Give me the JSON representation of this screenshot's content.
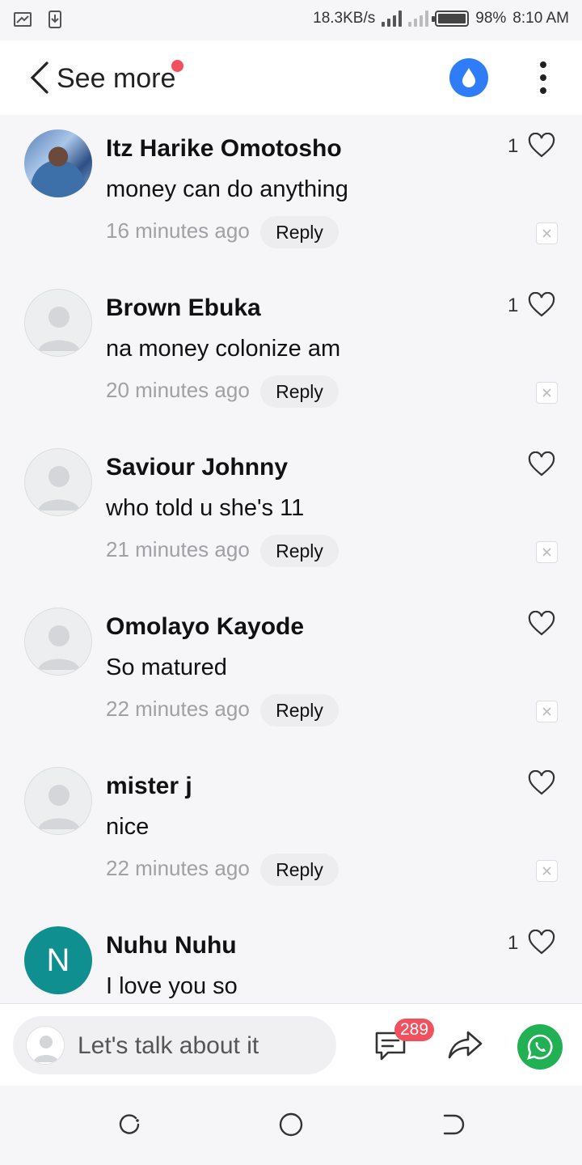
{
  "status_bar": {
    "net_speed": "18.3KB/s",
    "battery": "98%",
    "time": "8:10 AM",
    "battery_level": 0.98
  },
  "header": {
    "back_label": "See more",
    "accent": "#2f7df6",
    "dot_color": "#f1505f"
  },
  "comments": [
    {
      "name": "Itz Harike Omotosho",
      "text": "money can do anything",
      "time": "16 minutes ago",
      "reply": "Reply",
      "likes": "1",
      "avatar": "photo"
    },
    {
      "name": "Brown Ebuka",
      "text": "na money colonize am",
      "time": "20 minutes ago",
      "reply": "Reply",
      "likes": "1",
      "avatar": "default"
    },
    {
      "name": "Saviour Johnny",
      "text": "who told u she's 11",
      "time": "21 minutes ago",
      "reply": "Reply",
      "likes": "",
      "avatar": "default"
    },
    {
      "name": "Omolayo Kayode",
      "text": "So matured",
      "time": "22 minutes ago",
      "reply": "Reply",
      "likes": "",
      "avatar": "default"
    },
    {
      "name": "mister j",
      "text": "nice",
      "time": "22 minutes ago",
      "reply": "Reply",
      "likes": "",
      "avatar": "default"
    },
    {
      "name": "Nuhu Nuhu",
      "text": "I love you so",
      "time": "",
      "reply": "",
      "likes": "1",
      "avatar": "letter",
      "avatar_letter": "N"
    }
  ],
  "bottom_bar": {
    "input_placeholder": "Let's talk about it",
    "comment_count": "289",
    "whatsapp_color": "#21b053"
  },
  "icons": {
    "back": "chevron-left-icon",
    "drop": "water-drop-icon",
    "more": "more-vertical-icon",
    "heart": "heart-icon",
    "dismiss": "close-icon",
    "comments": "comment-icon",
    "share": "share-icon",
    "whatsapp": "whatsapp-icon",
    "nav": [
      "recent-apps-icon",
      "home-icon",
      "back-icon"
    ]
  }
}
